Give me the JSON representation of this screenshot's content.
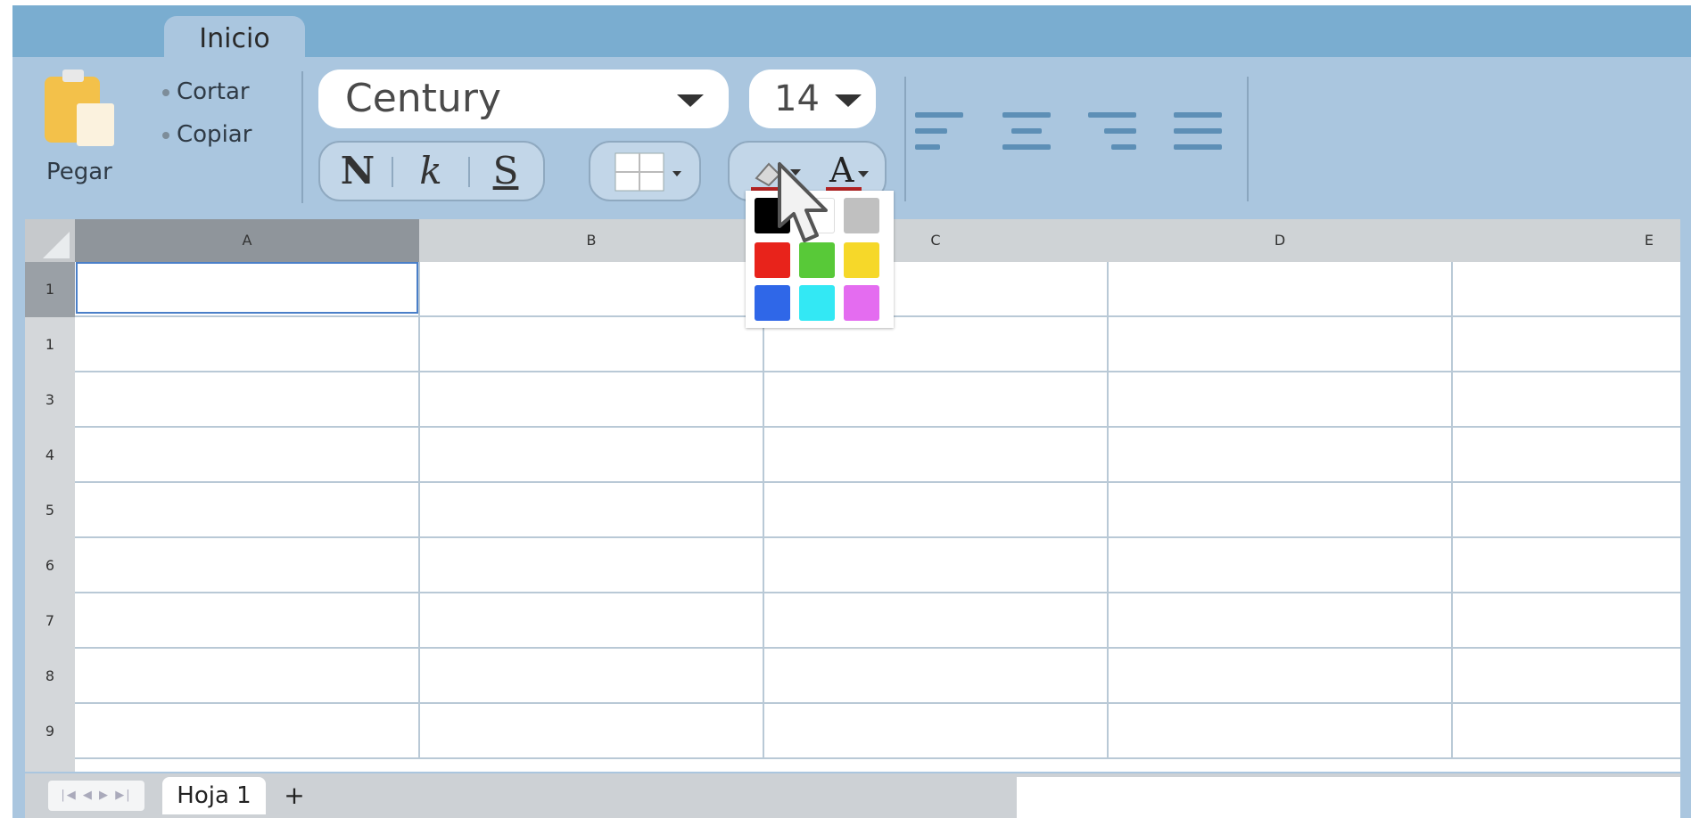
{
  "ribbon": {
    "tab_label": "Inicio",
    "paste_label": "Pegar",
    "cut_label": "Cortar",
    "copy_label": "Copiar",
    "font_name": "Century",
    "font_size": "14",
    "bold_label": "N",
    "italic_label": "k",
    "underline_label": "S",
    "font_color_label": "A"
  },
  "grid": {
    "columns": [
      "A",
      "B",
      "C",
      "D",
      "E"
    ],
    "rows": [
      "1",
      "1",
      "3",
      "4",
      "5",
      "6",
      "7",
      "8",
      "9"
    ]
  },
  "sheets": {
    "tab_label": "Hoja 1",
    "add_label": "+",
    "nav_label": "|◀ ◀ ▶ ▶|"
  },
  "color_palette": {
    "swatches": [
      "#000000",
      "#ffffff",
      "#c0c0c0",
      "#e8231b",
      "#58c938",
      "#f6d829",
      "#2f67e8",
      "#33e8f4",
      "#e46cf0"
    ]
  },
  "colors": {
    "tab_bar": "#7aadd0",
    "ribbon": "#aac6df",
    "selection": "#4a7fc8",
    "accent_underline": "#b22222"
  }
}
